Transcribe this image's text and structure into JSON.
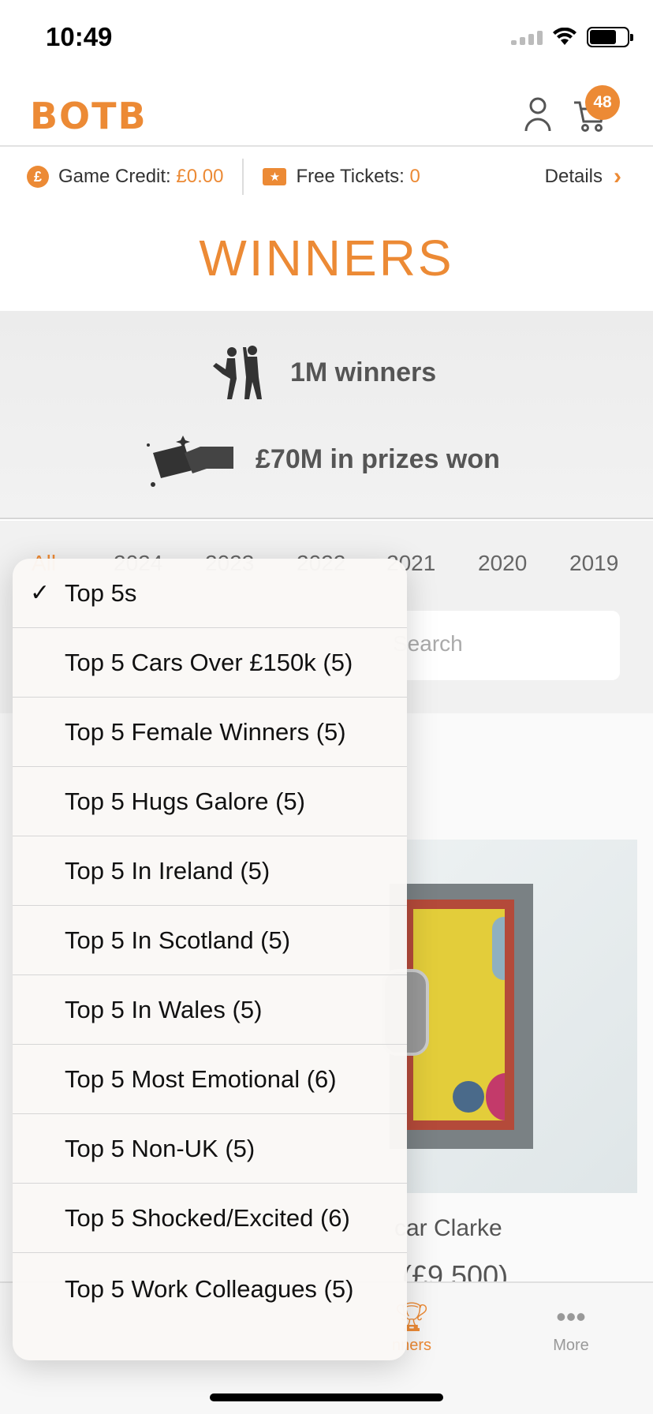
{
  "status_bar": {
    "time": "10:49"
  },
  "header": {
    "logo": "BOTB",
    "cart_count": "48"
  },
  "credits": {
    "game_credit_label": "Game Credit:",
    "game_credit_value": "£0.00",
    "free_tickets_label": "Free Tickets:",
    "free_tickets_value": "0",
    "details_label": "Details"
  },
  "page_title": "WINNERS",
  "stats": {
    "winners": "1M winners",
    "prizes": "£70M in prizes won"
  },
  "years": [
    "All",
    "2024",
    "2023",
    "2022",
    "2021",
    "2020",
    "2019"
  ],
  "search": {
    "placeholder": "Search"
  },
  "content": {
    "winner_name": "car Clarke",
    "winner_prize": "(£9,500)"
  },
  "tabs": {
    "winners": "nners",
    "more": "More"
  },
  "menu": {
    "items": [
      {
        "label": "Top 5s",
        "selected": true
      },
      {
        "label": "Top 5 Cars Over £150k (5)",
        "selected": false
      },
      {
        "label": "Top 5 Female Winners (5)",
        "selected": false
      },
      {
        "label": "Top 5 Hugs Galore (5)",
        "selected": false
      },
      {
        "label": "Top 5 In Ireland (5)",
        "selected": false
      },
      {
        "label": "Top 5 In Scotland (5)",
        "selected": false
      },
      {
        "label": "Top 5 In Wales (5)",
        "selected": false
      },
      {
        "label": "Top 5 Most Emotional (6)",
        "selected": false
      },
      {
        "label": "Top 5 Non-UK (5)",
        "selected": false
      },
      {
        "label": "Top 5 Shocked/Excited (6)",
        "selected": false
      },
      {
        "label": "Top 5 Work Colleagues (5)",
        "selected": false
      }
    ]
  },
  "colors": {
    "accent": "#ec8a35"
  }
}
